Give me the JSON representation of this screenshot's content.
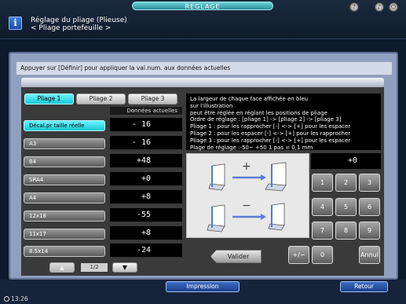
{
  "header": {
    "tab_title": "REGLAGE",
    "title_line1": "Réglage du pliage (Plieuse)",
    "title_line2": "< Pliage portefeuille >",
    "icons": [
      "info-icon",
      "help-icon",
      "volume-icon",
      "power-icon"
    ]
  },
  "instruction": "Appuyer sur [Définir] pour appliquer la val.num. aux données actuelles",
  "tabs": [
    {
      "label": "Pliage 1",
      "active": true
    },
    {
      "label": "Pliage 2",
      "active": false
    },
    {
      "label": "Pliage 3",
      "active": false
    }
  ],
  "column_header": "Données actuelles",
  "rows": [
    {
      "label": "Décal.pr taille réelle",
      "value": "- 16",
      "selected": true
    },
    {
      "label": "A3",
      "value": "- 16",
      "selected": false
    },
    {
      "label": "B4",
      "value": "+48",
      "selected": false
    },
    {
      "label": "SRA4",
      "value": "+0",
      "selected": false
    },
    {
      "label": "A4",
      "value": "+8",
      "selected": false
    },
    {
      "label": "12x18",
      "value": "-55",
      "selected": false
    },
    {
      "label": "11x17",
      "value": "+8",
      "selected": false
    },
    {
      "label": "8.5x14",
      "value": "-24",
      "selected": false
    }
  ],
  "paging": {
    "label": "1/2",
    "up": "▲",
    "down": "▼"
  },
  "info_text": "La largeur de chaque face affichée en bleu\nsur l'illustration\npeut être réglée en réglant les positions de pliage\nOrdre de réglage : [pliage 1] -> [pliage 2] -> [pliage 3]\nPliage 1 : pour les rapprocher [-] <-> [+] pour les espacer\nPliage 2 : pour les espacer [-] <-> [+] pour les rapprocher\nPliage 3 : pour les rapprocher [-] <-> [+] pour les espacer\nPlage de réglage :-50~ +50 1 pas = 0,1 mm",
  "diagram": {
    "plus": "+",
    "minus": "−"
  },
  "keypad": {
    "display": "+0",
    "keys": [
      "1",
      "2",
      "3",
      "4",
      "5",
      "6",
      "7",
      "8",
      "9"
    ],
    "plus_minus": "+/−",
    "zero": "0",
    "cancel": "Annul",
    "valider": "Valider"
  },
  "bottom": {
    "impression": "Impression",
    "retour": "Retour",
    "time": "13:26"
  }
}
